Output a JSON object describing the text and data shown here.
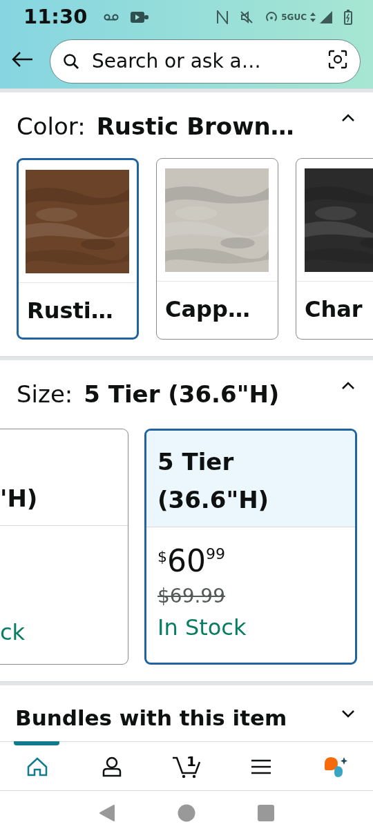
{
  "status_bar": {
    "time": "11:30",
    "network": "5GUC"
  },
  "header": {
    "search": {
      "placeholder": "Search or ask a…"
    }
  },
  "color_section": {
    "label": "Color:",
    "value": "Rustic Brown…",
    "expanded": true,
    "swatches": [
      {
        "name": "Rusti…",
        "color": "#6b4328",
        "selected": true
      },
      {
        "name": "Capp…",
        "color": "#c8c4bc",
        "selected": false
      },
      {
        "name": "Char",
        "color": "#2b2b2b",
        "selected": false
      }
    ]
  },
  "size_section": {
    "label": "Size:",
    "value": "5 Tier (36.6\"H)",
    "expanded": true,
    "options": [
      {
        "label": "'H)",
        "stock": "ck",
        "selected": false
      },
      {
        "label": "5 Tier (36.6\"H)",
        "currency": "$",
        "price_whole": "60",
        "price_fraction": "99",
        "list_price": "$69.99",
        "stock": "In Stock",
        "selected": true
      }
    ]
  },
  "bundles": {
    "title": "Bundles with this item",
    "expanded": false
  },
  "bottom_nav": [
    {
      "kind": "home",
      "selected": true
    },
    {
      "kind": "account",
      "selected": false
    },
    {
      "kind": "cart",
      "count": "1",
      "selected": false
    },
    {
      "kind": "menu",
      "selected": false
    },
    {
      "kind": "assistant",
      "selected": false
    }
  ]
}
